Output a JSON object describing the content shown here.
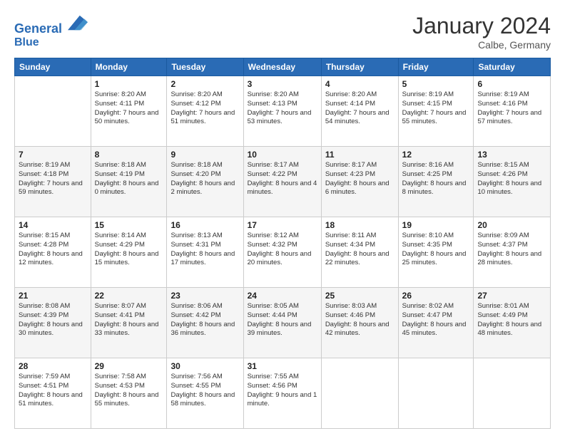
{
  "header": {
    "logo_line1": "General",
    "logo_line2": "Blue",
    "month_title": "January 2024",
    "location": "Calbe, Germany"
  },
  "weekdays": [
    "Sunday",
    "Monday",
    "Tuesday",
    "Wednesday",
    "Thursday",
    "Friday",
    "Saturday"
  ],
  "weeks": [
    [
      {
        "day": "",
        "sunrise": "",
        "sunset": "",
        "daylight": ""
      },
      {
        "day": "1",
        "sunrise": "Sunrise: 8:20 AM",
        "sunset": "Sunset: 4:11 PM",
        "daylight": "Daylight: 7 hours and 50 minutes."
      },
      {
        "day": "2",
        "sunrise": "Sunrise: 8:20 AM",
        "sunset": "Sunset: 4:12 PM",
        "daylight": "Daylight: 7 hours and 51 minutes."
      },
      {
        "day": "3",
        "sunrise": "Sunrise: 8:20 AM",
        "sunset": "Sunset: 4:13 PM",
        "daylight": "Daylight: 7 hours and 53 minutes."
      },
      {
        "day": "4",
        "sunrise": "Sunrise: 8:20 AM",
        "sunset": "Sunset: 4:14 PM",
        "daylight": "Daylight: 7 hours and 54 minutes."
      },
      {
        "day": "5",
        "sunrise": "Sunrise: 8:19 AM",
        "sunset": "Sunset: 4:15 PM",
        "daylight": "Daylight: 7 hours and 55 minutes."
      },
      {
        "day": "6",
        "sunrise": "Sunrise: 8:19 AM",
        "sunset": "Sunset: 4:16 PM",
        "daylight": "Daylight: 7 hours and 57 minutes."
      }
    ],
    [
      {
        "day": "7",
        "sunrise": "Sunrise: 8:19 AM",
        "sunset": "Sunset: 4:18 PM",
        "daylight": "Daylight: 7 hours and 59 minutes."
      },
      {
        "day": "8",
        "sunrise": "Sunrise: 8:18 AM",
        "sunset": "Sunset: 4:19 PM",
        "daylight": "Daylight: 8 hours and 0 minutes."
      },
      {
        "day": "9",
        "sunrise": "Sunrise: 8:18 AM",
        "sunset": "Sunset: 4:20 PM",
        "daylight": "Daylight: 8 hours and 2 minutes."
      },
      {
        "day": "10",
        "sunrise": "Sunrise: 8:17 AM",
        "sunset": "Sunset: 4:22 PM",
        "daylight": "Daylight: 8 hours and 4 minutes."
      },
      {
        "day": "11",
        "sunrise": "Sunrise: 8:17 AM",
        "sunset": "Sunset: 4:23 PM",
        "daylight": "Daylight: 8 hours and 6 minutes."
      },
      {
        "day": "12",
        "sunrise": "Sunrise: 8:16 AM",
        "sunset": "Sunset: 4:25 PM",
        "daylight": "Daylight: 8 hours and 8 minutes."
      },
      {
        "day": "13",
        "sunrise": "Sunrise: 8:15 AM",
        "sunset": "Sunset: 4:26 PM",
        "daylight": "Daylight: 8 hours and 10 minutes."
      }
    ],
    [
      {
        "day": "14",
        "sunrise": "Sunrise: 8:15 AM",
        "sunset": "Sunset: 4:28 PM",
        "daylight": "Daylight: 8 hours and 12 minutes."
      },
      {
        "day": "15",
        "sunrise": "Sunrise: 8:14 AM",
        "sunset": "Sunset: 4:29 PM",
        "daylight": "Daylight: 8 hours and 15 minutes."
      },
      {
        "day": "16",
        "sunrise": "Sunrise: 8:13 AM",
        "sunset": "Sunset: 4:31 PM",
        "daylight": "Daylight: 8 hours and 17 minutes."
      },
      {
        "day": "17",
        "sunrise": "Sunrise: 8:12 AM",
        "sunset": "Sunset: 4:32 PM",
        "daylight": "Daylight: 8 hours and 20 minutes."
      },
      {
        "day": "18",
        "sunrise": "Sunrise: 8:11 AM",
        "sunset": "Sunset: 4:34 PM",
        "daylight": "Daylight: 8 hours and 22 minutes."
      },
      {
        "day": "19",
        "sunrise": "Sunrise: 8:10 AM",
        "sunset": "Sunset: 4:35 PM",
        "daylight": "Daylight: 8 hours and 25 minutes."
      },
      {
        "day": "20",
        "sunrise": "Sunrise: 8:09 AM",
        "sunset": "Sunset: 4:37 PM",
        "daylight": "Daylight: 8 hours and 28 minutes."
      }
    ],
    [
      {
        "day": "21",
        "sunrise": "Sunrise: 8:08 AM",
        "sunset": "Sunset: 4:39 PM",
        "daylight": "Daylight: 8 hours and 30 minutes."
      },
      {
        "day": "22",
        "sunrise": "Sunrise: 8:07 AM",
        "sunset": "Sunset: 4:41 PM",
        "daylight": "Daylight: 8 hours and 33 minutes."
      },
      {
        "day": "23",
        "sunrise": "Sunrise: 8:06 AM",
        "sunset": "Sunset: 4:42 PM",
        "daylight": "Daylight: 8 hours and 36 minutes."
      },
      {
        "day": "24",
        "sunrise": "Sunrise: 8:05 AM",
        "sunset": "Sunset: 4:44 PM",
        "daylight": "Daylight: 8 hours and 39 minutes."
      },
      {
        "day": "25",
        "sunrise": "Sunrise: 8:03 AM",
        "sunset": "Sunset: 4:46 PM",
        "daylight": "Daylight: 8 hours and 42 minutes."
      },
      {
        "day": "26",
        "sunrise": "Sunrise: 8:02 AM",
        "sunset": "Sunset: 4:47 PM",
        "daylight": "Daylight: 8 hours and 45 minutes."
      },
      {
        "day": "27",
        "sunrise": "Sunrise: 8:01 AM",
        "sunset": "Sunset: 4:49 PM",
        "daylight": "Daylight: 8 hours and 48 minutes."
      }
    ],
    [
      {
        "day": "28",
        "sunrise": "Sunrise: 7:59 AM",
        "sunset": "Sunset: 4:51 PM",
        "daylight": "Daylight: 8 hours and 51 minutes."
      },
      {
        "day": "29",
        "sunrise": "Sunrise: 7:58 AM",
        "sunset": "Sunset: 4:53 PM",
        "daylight": "Daylight: 8 hours and 55 minutes."
      },
      {
        "day": "30",
        "sunrise": "Sunrise: 7:56 AM",
        "sunset": "Sunset: 4:55 PM",
        "daylight": "Daylight: 8 hours and 58 minutes."
      },
      {
        "day": "31",
        "sunrise": "Sunrise: 7:55 AM",
        "sunset": "Sunset: 4:56 PM",
        "daylight": "Daylight: 9 hours and 1 minute."
      },
      {
        "day": "",
        "sunrise": "",
        "sunset": "",
        "daylight": ""
      },
      {
        "day": "",
        "sunrise": "",
        "sunset": "",
        "daylight": ""
      },
      {
        "day": "",
        "sunrise": "",
        "sunset": "",
        "daylight": ""
      }
    ]
  ]
}
